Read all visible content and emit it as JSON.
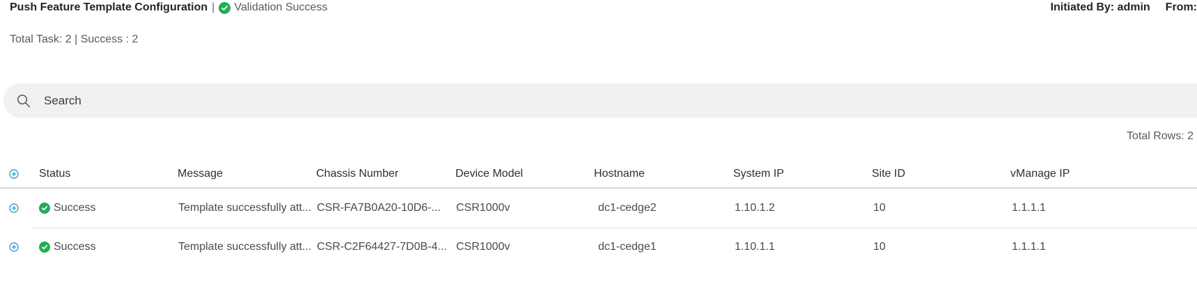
{
  "header": {
    "title": "Push Feature Template Configuration",
    "separator": "|",
    "validation_status": "Validation Success",
    "initiated_by": "Initiated By: admin",
    "from_label": "From:"
  },
  "summary": {
    "text": "Total Task: 2 | Success : 2"
  },
  "search": {
    "placeholder": "Search"
  },
  "table": {
    "total_rows": "Total Rows: 2",
    "columns": {
      "status": "Status",
      "message": "Message",
      "chassis_number": "Chassis Number",
      "device_model": "Device Model",
      "hostname": "Hostname",
      "system_ip": "System IP",
      "site_id": "Site ID",
      "vmanage_ip": "vManage IP"
    },
    "rows": [
      {
        "status": "Success",
        "message": "Template successfully att...",
        "chassis_number": "CSR-FA7B0A20-10D6-...",
        "device_model": "CSR1000v",
        "hostname": "dc1-cedge2",
        "system_ip": "1.10.1.2",
        "site_id": "10",
        "vmanage_ip": "1.1.1.1"
      },
      {
        "status": "Success",
        "message": "Template successfully att...",
        "chassis_number": "CSR-C2F64427-7D0B-4...",
        "device_model": "CSR1000v",
        "hostname": "dc1-cedge1",
        "system_ip": "1.10.1.1",
        "site_id": "10",
        "vmanage_ip": "1.1.1.1"
      }
    ]
  },
  "colors": {
    "success_green": "#1fae54",
    "expand_blue": "#1d8bd1",
    "search_bg": "#f0f1f2"
  },
  "icons": {
    "validation": "check-circle-icon",
    "search": "search-icon",
    "expand": "plus-circle-icon",
    "status": "check-circle-icon"
  }
}
